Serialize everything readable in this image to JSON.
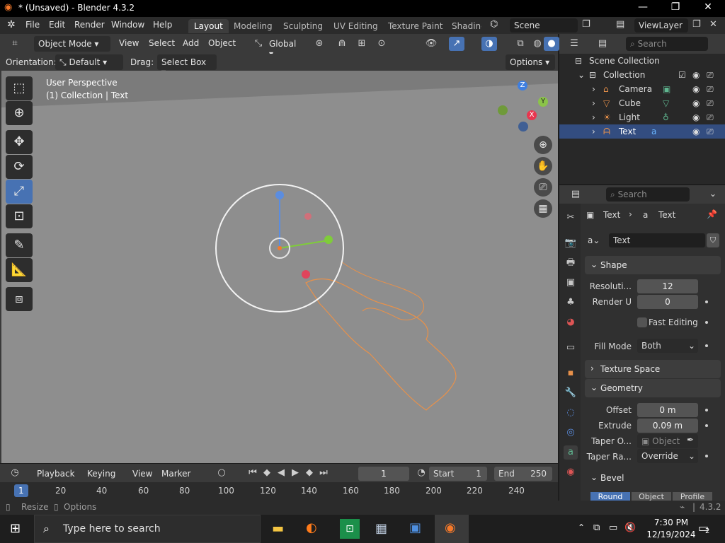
{
  "window": {
    "title": "* (Unsaved) - Blender 4.3.2",
    "minimize": "—",
    "maximize": "❐",
    "close": "✕"
  },
  "menus": [
    "File",
    "Edit",
    "Render",
    "Window",
    "Help"
  ],
  "workspaces": [
    "Layout",
    "Modeling",
    "Sculpting",
    "UV Editing",
    "Texture Paint",
    "Shading"
  ],
  "scene": {
    "name": "Scene",
    "view_layer": "ViewLayer"
  },
  "viewport_header": {
    "mode": "Object Mode",
    "menus": [
      "View",
      "Select",
      "Add",
      "Object"
    ],
    "transform_orientation": "Global"
  },
  "tool_options": {
    "orientation_label": "Orientation:",
    "orientation_value": "Default",
    "drag_label": "Drag:",
    "drag_value": "Select Box",
    "options_label": "Options"
  },
  "viewport": {
    "perspective": "User Perspective",
    "collection_info": "(1) Collection | Text",
    "gizmo_axes": {
      "x": "X",
      "y": "Y",
      "z": "Z"
    }
  },
  "outliner": {
    "search_placeholder": "Search",
    "items": [
      {
        "label": "Scene Collection"
      },
      {
        "label": "Collection"
      },
      {
        "label": "Camera"
      },
      {
        "label": "Cube"
      },
      {
        "label": "Light"
      },
      {
        "label": "Text"
      }
    ]
  },
  "properties": {
    "search_placeholder": "Search",
    "breadcrumb": [
      "Text",
      "Text"
    ],
    "datablock": "Text",
    "shape_panel": "Shape",
    "resolution_label": "Resoluti...",
    "resolution_value": "12",
    "render_u_label": "Render U",
    "render_u_value": "0",
    "fast_editing_label": "Fast Editing",
    "fill_mode_label": "Fill Mode",
    "fill_mode_value": "Both",
    "texture_space_panel": "Texture Space",
    "geometry_panel": "Geometry",
    "offset_label": "Offset",
    "offset_value": "0 m",
    "extrude_label": "Extrude",
    "extrude_value": "0.09 m",
    "taper_object_label": "Taper O...",
    "taper_object_placeholder": "Object",
    "taper_radius_label": "Taper Ra...",
    "taper_radius_value": "Override",
    "bevel_panel": "Bevel",
    "bevel_tabs": [
      "Round",
      "Object",
      "Profile"
    ]
  },
  "timeline": {
    "menus": [
      "Playback",
      "Keying",
      "View",
      "Marker"
    ],
    "current_frame": "1",
    "start_label": "Start",
    "start_value": "1",
    "end_label": "End",
    "end_value": "250",
    "ruler": [
      "1",
      "20",
      "40",
      "60",
      "80",
      "100",
      "120",
      "140",
      "160",
      "180",
      "200",
      "220",
      "240"
    ]
  },
  "statusbar": {
    "resize": "Resize",
    "options": "Options",
    "version": "4.3.2"
  },
  "taskbar": {
    "search_placeholder": "Type here to search",
    "time": "7:30 PM",
    "date": "12/19/2024",
    "notifications": "2"
  },
  "colors": {
    "accent": "#4772b3",
    "selection": "#334d80",
    "viewport": "#8e8e8e",
    "curve": "#e8914a"
  }
}
